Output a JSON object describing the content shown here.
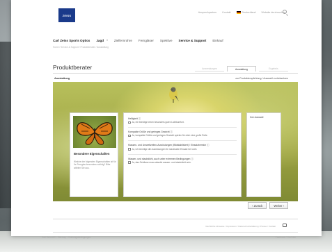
{
  "header": {
    "logo_text": "ZEISS",
    "top_links": [
      "Ansprechpartner",
      "Kontakt",
      "Deutschland",
      "Website durchsuchen"
    ]
  },
  "nav": {
    "items": [
      {
        "label": "Carl Zeiss Sports Optics",
        "strong": true
      },
      {
        "label": "Jagd",
        "strong": true
      },
      {
        "label": "Zielfernrohre",
        "strong": false
      },
      {
        "label": "Ferngläser",
        "strong": false
      },
      {
        "label": "Spektive",
        "strong": false
      },
      {
        "label": "Service & Support",
        "strong": true
      },
      {
        "label": "Einkauf",
        "strong": false
      }
    ],
    "breadcrumb": "Home / Service & Support / Produktberater / Ausstattung"
  },
  "page": {
    "title": "Produktberater",
    "steps": [
      "Anwendungen",
      "Ausstattung",
      "Ergebnis"
    ],
    "subbar_left": "Ausstattung",
    "subbar_right": "zur Produktempfehlung / Auswahl zurücksetzen"
  },
  "info_card": {
    "title": "Besondere Eigenschaften",
    "text": "Welche der folgenden Eigenschaften ist für Ihr Fernglas besonders wichtig? Bitte wählen Sie aus."
  },
  "questions": [
    {
      "label": "Helligkeit ⓘ",
      "option": "Ja, mir benötige einen besonders guten Lichtkomfort."
    },
    {
      "label": "Kompakte Größe und geringes Gewicht ⓘ",
      "option": "Ja, kompakte Größe und geringes Gewicht spielen für mich eine große Rolle."
    },
    {
      "label": "Klassen- und Umweltzeiten-Ausrüstungen (Bildstabilisiert) / Einsatzbereich ⓘ",
      "option": "Ja, ich benötige die Ausrüstungen für maximalen Einsatz bei Licht."
    },
    {
      "label": "Wasser- und staubdicht, auch unter extremen Bedingungen ⓘ",
      "option": "Ja, das Gehäuse muss absolut wasser- und staubdicht sein."
    }
  ],
  "side_card": {
    "title": "Ihre Auswahl"
  },
  "buttons": {
    "back": "‹ Zurück",
    "next": "Weiter ›"
  },
  "footer": {
    "links": "Rechtliche Hinweise / Impressum / Datenschutzerklärung / Presse / Kontakt",
    "left": "Carl Zeiss AG – Sitemap – Nutzungsbedingungen",
    "right": "Facebook / YouTube"
  }
}
